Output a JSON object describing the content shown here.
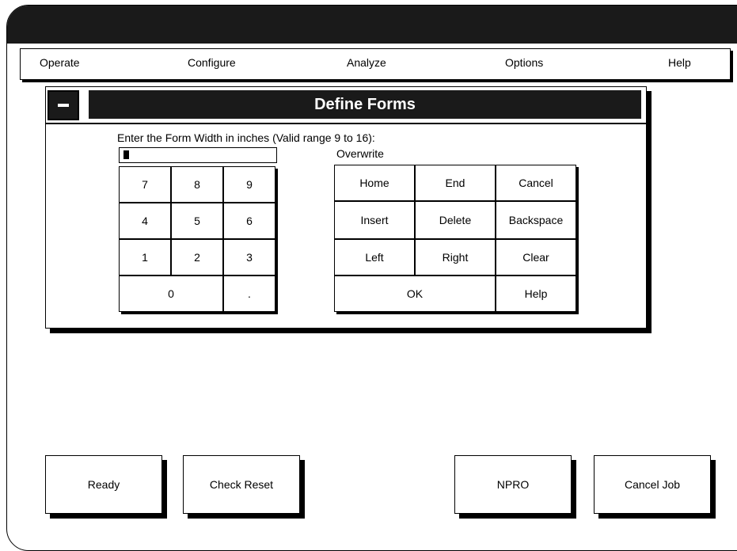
{
  "menu": {
    "items": [
      "Operate",
      "Configure",
      "Analyze",
      "Options",
      "Help"
    ]
  },
  "dialog": {
    "title": "Define Forms",
    "prompt": "Enter the Form Width in inches (Valid range 9 to 16):",
    "entry_value": "",
    "mode": "Overwrite"
  },
  "keypad": {
    "k7": "7",
    "k8": "8",
    "k9": "9",
    "k4": "4",
    "k5": "5",
    "k6": "6",
    "k1": "1",
    "k2": "2",
    "k3": "3",
    "k0": "0",
    "dot": "."
  },
  "editkeys": {
    "home": "Home",
    "end": "End",
    "cancel": "Cancel",
    "insert": "Insert",
    "delete": "Delete",
    "backspace": "Backspace",
    "left": "Left",
    "right": "Right",
    "clear": "Clear",
    "ok": "OK",
    "help": "Help"
  },
  "bottom": {
    "ready": "Ready",
    "check_reset": "Check Reset",
    "npro": "NPRO",
    "cancel_job": "Cancel Job"
  }
}
